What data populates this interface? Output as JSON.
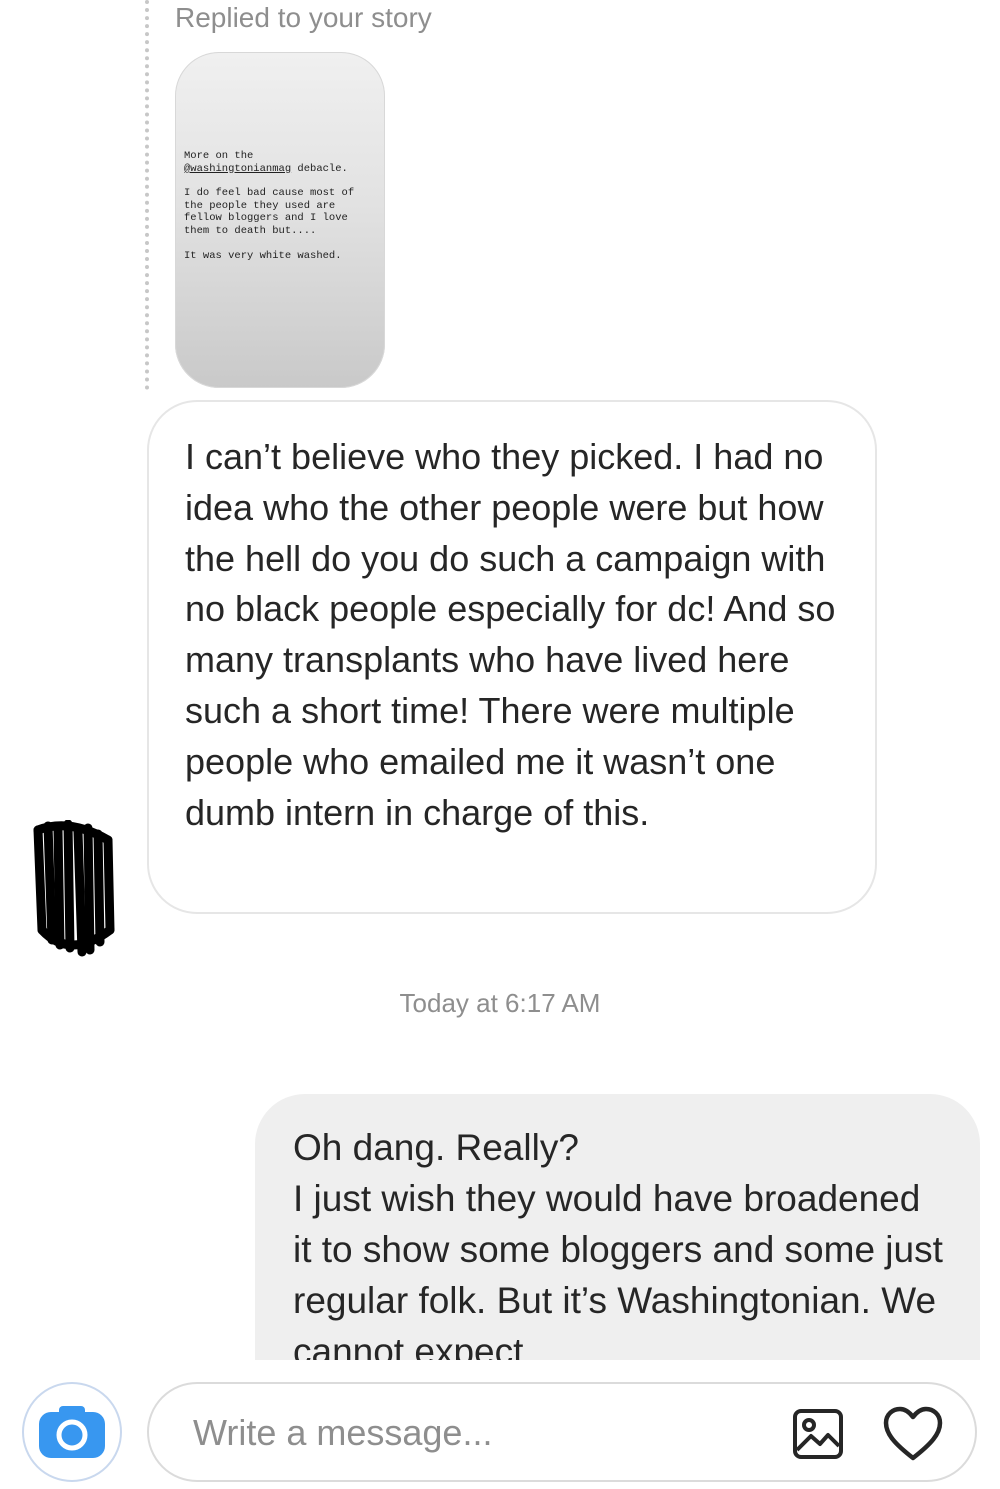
{
  "story_reply": {
    "label": "Replied to your story",
    "story_text": {
      "line1": "More on the",
      "mention": "@washingtonianmag",
      "line2_rest": " debacle.",
      "para2": "I do feel bad cause most of the people they used are fellow bloggers and I love them to death but....",
      "para3": "It was very white washed."
    }
  },
  "incoming_message": {
    "text": "I can’t believe who they picked. I had no idea who the other people were but how the hell do you do such a campaign with no black people especially for dc! And so many transplants who have lived here such a short time! There were multiple people who emailed me it wasn’t one dumb intern in charge of this."
  },
  "timestamp": "Today at 6:17 AM",
  "outgoing_message": {
    "line1": "Oh dang. Really?",
    "line2": "I just wish they would have broadened it to show some bloggers and some just regular folk. But it’s Washingtonian. We cannot expect"
  },
  "composer": {
    "placeholder": "Write a message...",
    "icons": [
      "camera-icon",
      "gallery-icon",
      "heart-icon"
    ],
    "accent_color": "#3897f0"
  }
}
